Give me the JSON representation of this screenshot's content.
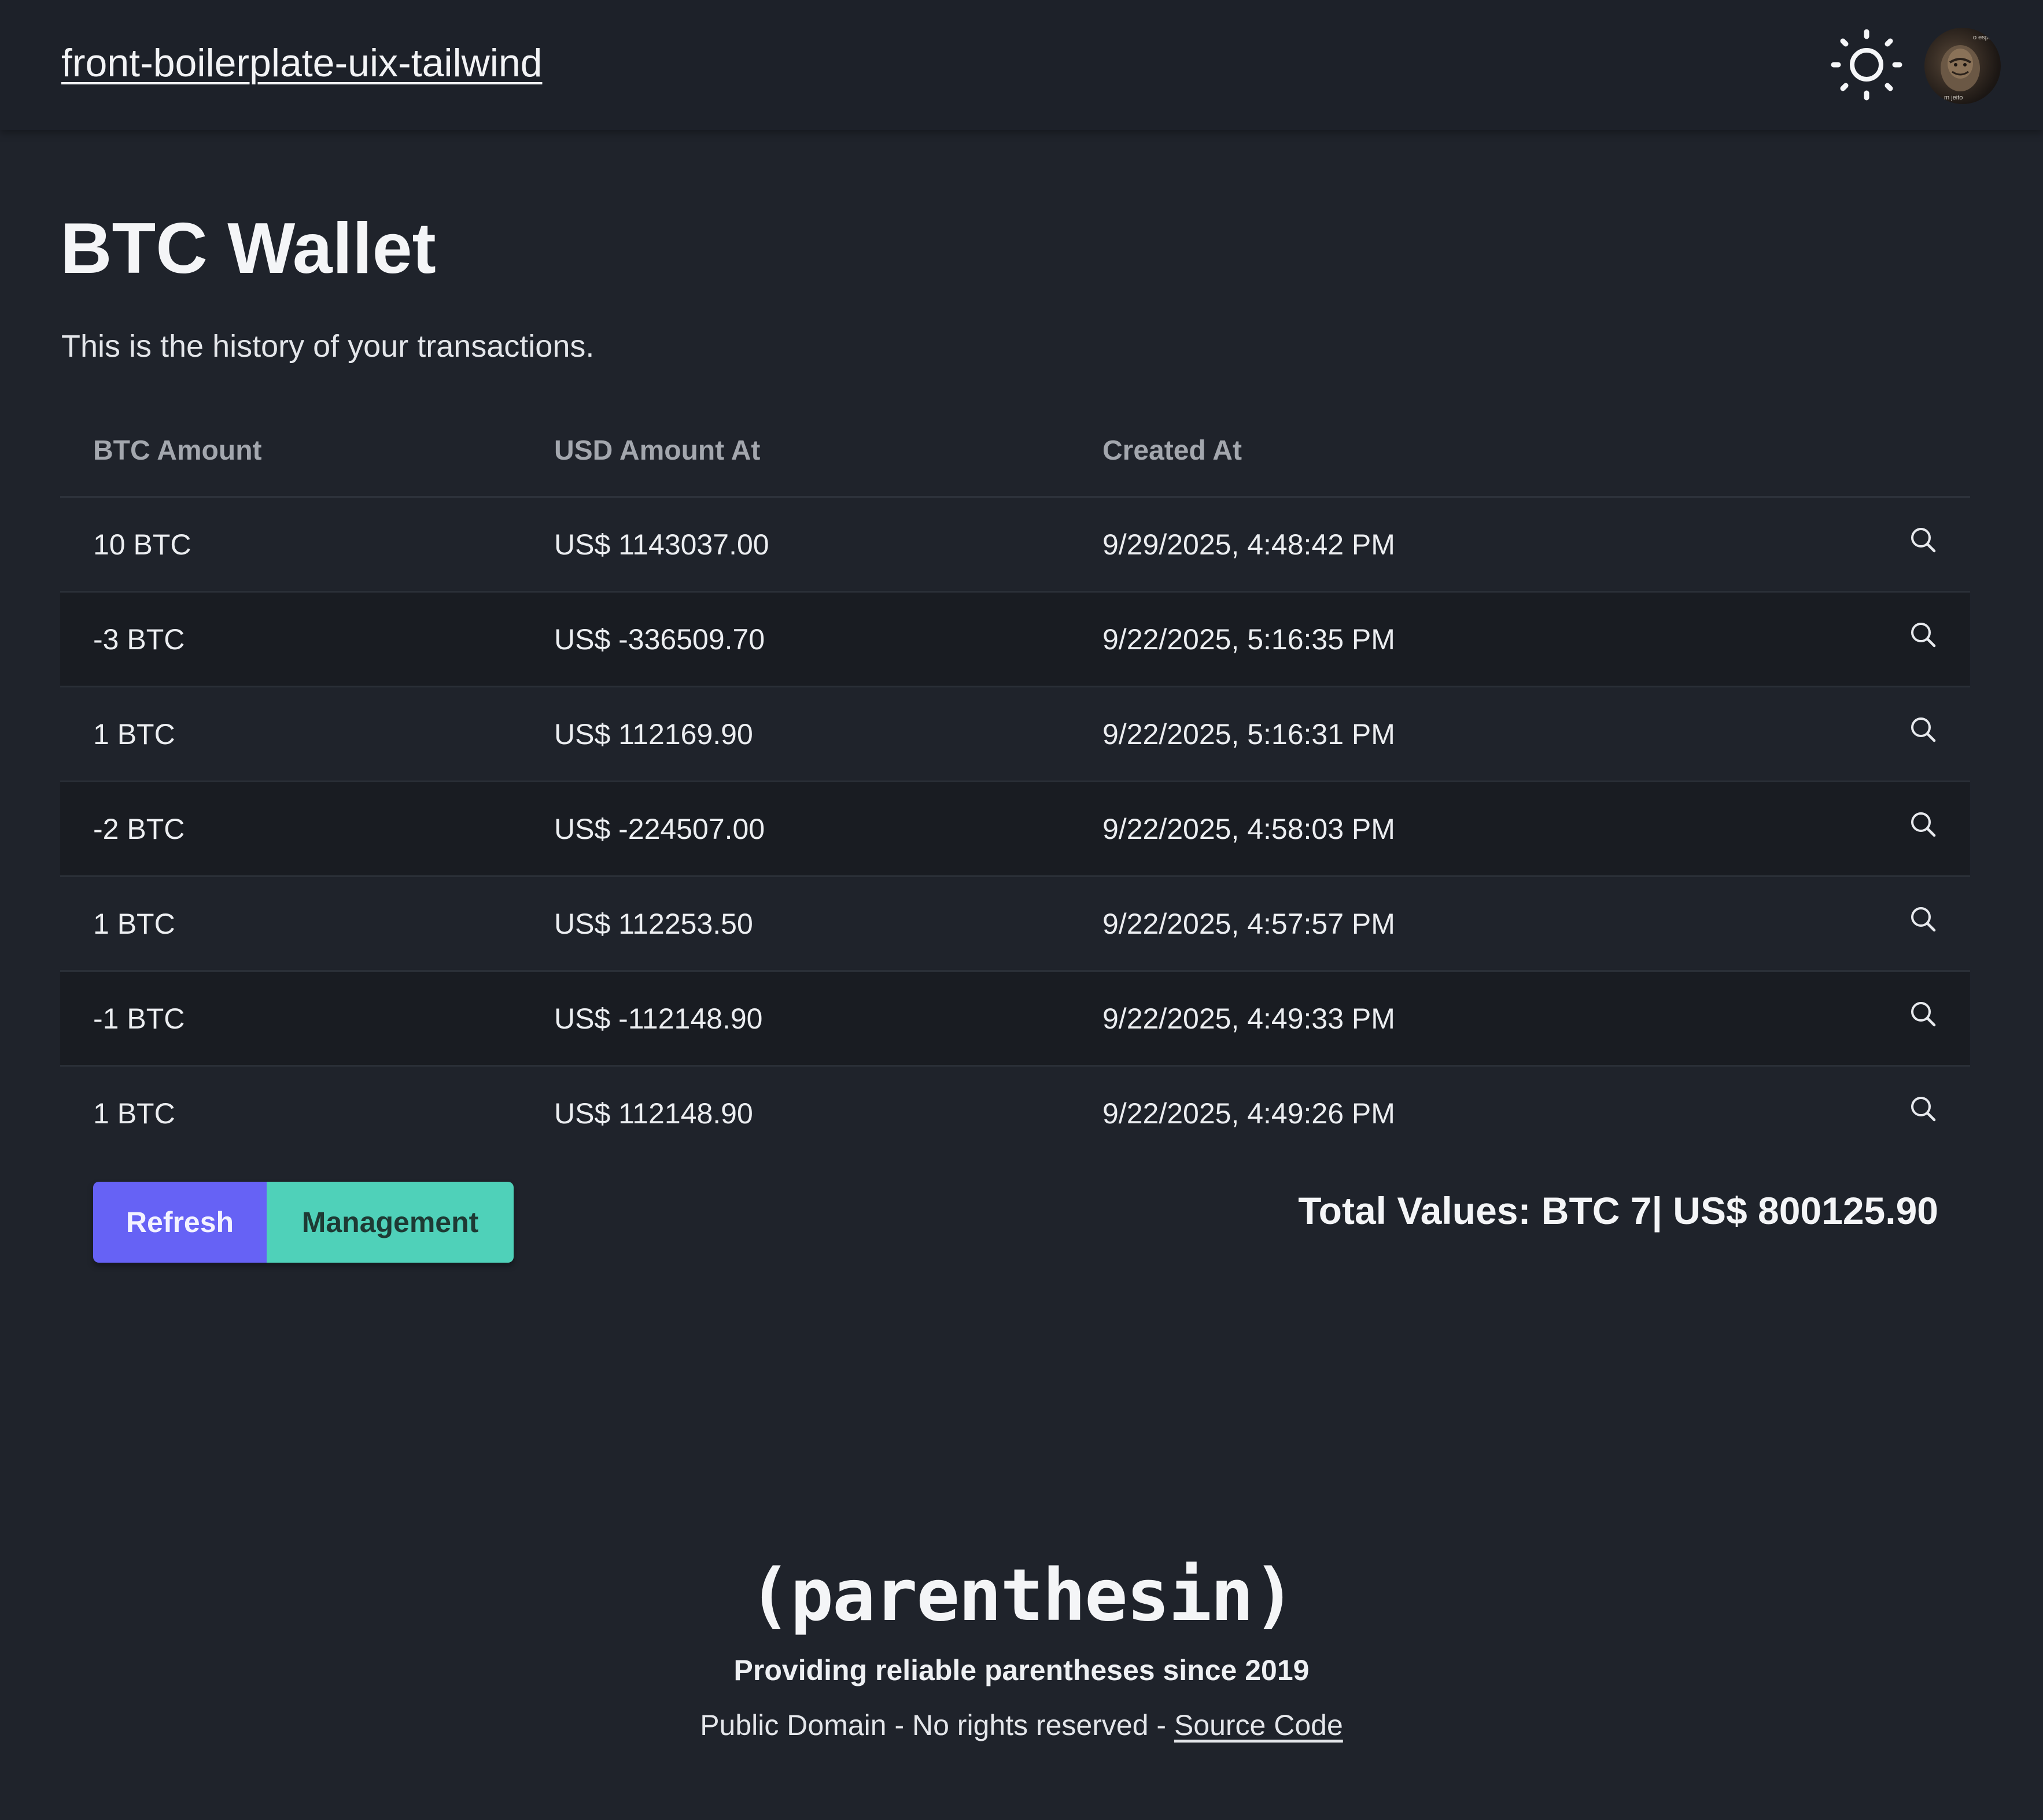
{
  "navbar": {
    "brand": "front-boilerplate-uix-tailwind",
    "theme_icon": "sun-icon",
    "avatar_icon": "user-avatar",
    "avatar_caption_top": "o especialis",
    "avatar_caption_bottom": "m jeito"
  },
  "main": {
    "title": "BTC Wallet",
    "subtitle": "This is the history of your transactions."
  },
  "table": {
    "headers": [
      "BTC Amount",
      "USD Amount At",
      "Created At"
    ],
    "row_action_icon": "search-icon",
    "rows": [
      {
        "btc": "10 BTC",
        "usd": "US$ 1143037.00",
        "created": "9/29/2025, 4:48:42 PM"
      },
      {
        "btc": "-3 BTC",
        "usd": "US$ -336509.70",
        "created": "9/22/2025, 5:16:35 PM"
      },
      {
        "btc": "1 BTC",
        "usd": "US$ 112169.90",
        "created": "9/22/2025, 5:16:31 PM"
      },
      {
        "btc": "-2 BTC",
        "usd": "US$ -224507.00",
        "created": "9/22/2025, 4:58:03 PM"
      },
      {
        "btc": "1 BTC",
        "usd": "US$ 112253.50",
        "created": "9/22/2025, 4:57:57 PM"
      },
      {
        "btc": "-1 BTC",
        "usd": "US$ -112148.90",
        "created": "9/22/2025, 4:49:33 PM"
      },
      {
        "btc": "1 BTC",
        "usd": "US$ 112148.90",
        "created": "9/22/2025, 4:49:26 PM"
      }
    ]
  },
  "actions": {
    "refresh_label": "Refresh",
    "management_label": "Management",
    "totals": "Total Values: BTC 7| US$ 800125.90"
  },
  "footer": {
    "logo": "(parenthesin)",
    "tagline": "Providing reliable parentheses since 2019",
    "legal": "Public Domain - No rights reserved - ",
    "source_link": "Source Code"
  },
  "colors": {
    "background": "#1f232b",
    "navbar": "#1d2129",
    "row_alt": "#191c22",
    "refresh_button": "#6662f5",
    "management_button": "#4fd1b9"
  }
}
